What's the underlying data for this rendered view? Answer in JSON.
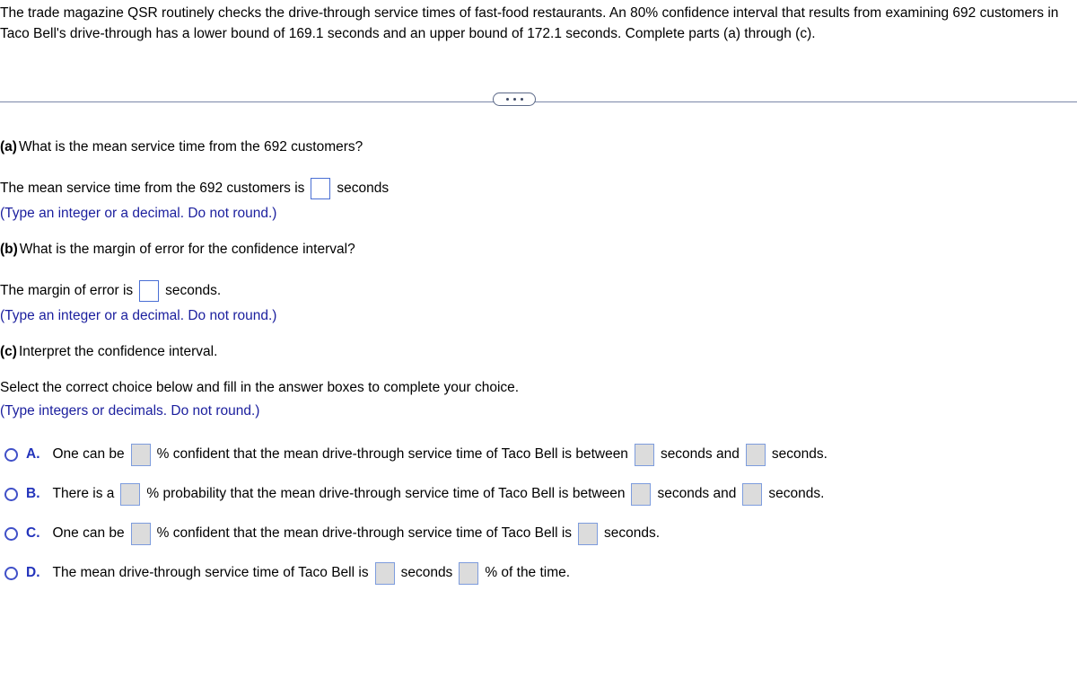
{
  "problem": {
    "statement": "The trade magazine QSR routinely checks the drive-through service times of fast-food restaurants. An 80% confidence interval that results from examining 692 customers in Taco Bell's drive-through has a lower bound of 169.1 seconds and an upper bound of 172.1 seconds. Complete parts (a) through (c).",
    "magazine": "QSR",
    "restaurant": "Taco Bell",
    "confidence_level": "80%",
    "sample_size": "692",
    "lower_bound": "169.1",
    "upper_bound": "172.1"
  },
  "divider": {
    "ellipsis_label": "..."
  },
  "part_a": {
    "label": "(a)",
    "question": "What is the mean service time from the 692 customers?",
    "answer_prefix": "The mean service time from the 692 customers is",
    "answer_suffix": "seconds",
    "answer_value": "",
    "hint": "(Type an integer or a decimal. Do not round.)"
  },
  "part_b": {
    "label": "(b)",
    "question": "What is the margin of error for the confidence interval?",
    "answer_prefix": "The margin of error is",
    "answer_suffix": "seconds.",
    "answer_value": "",
    "hint": "(Type an integer or a decimal. Do not round.)"
  },
  "part_c": {
    "label": "(c)",
    "question": "Interpret the confidence interval.",
    "instruction": "Select the correct choice below and fill in the answer boxes to complete your choice.",
    "hint": "(Type integers or decimals. Do not round.)",
    "choices": [
      {
        "letter": "A.",
        "selected": false,
        "segments": [
          {
            "type": "text",
            "value": "One can be"
          },
          {
            "type": "box",
            "value": ""
          },
          {
            "type": "text",
            "value": "% confident that the mean drive-through service time of Taco Bell is between"
          },
          {
            "type": "box",
            "value": ""
          },
          {
            "type": "text",
            "value": "seconds and"
          },
          {
            "type": "box",
            "value": ""
          },
          {
            "type": "text",
            "value": "seconds."
          }
        ]
      },
      {
        "letter": "B.",
        "selected": false,
        "segments": [
          {
            "type": "text",
            "value": "There is a"
          },
          {
            "type": "box",
            "value": ""
          },
          {
            "type": "text",
            "value": "% probability that the mean drive-through service time of Taco Bell is between"
          },
          {
            "type": "box",
            "value": ""
          },
          {
            "type": "text",
            "value": "seconds and"
          },
          {
            "type": "box",
            "value": ""
          },
          {
            "type": "text",
            "value": "seconds."
          }
        ]
      },
      {
        "letter": "C.",
        "selected": false,
        "segments": [
          {
            "type": "text",
            "value": "One can be"
          },
          {
            "type": "box",
            "value": ""
          },
          {
            "type": "text",
            "value": "% confident that the mean drive-through service time of Taco Bell is"
          },
          {
            "type": "box",
            "value": ""
          },
          {
            "type": "text",
            "value": "seconds."
          }
        ]
      },
      {
        "letter": "D.",
        "selected": false,
        "segments": [
          {
            "type": "text",
            "value": "The mean drive-through service time of Taco Bell is"
          },
          {
            "type": "box",
            "value": ""
          },
          {
            "type": "text",
            "value": "seconds"
          },
          {
            "type": "box",
            "value": ""
          },
          {
            "type": "text",
            "value": "% of the time."
          }
        ]
      }
    ]
  },
  "colors": {
    "hint_blue": "#1b1f9e",
    "choice_letter_blue": "#2233bb",
    "radio_blue": "#4050c8",
    "box_border_white": "#4a6fd4",
    "box_border_gray": "#7d9cdd",
    "box_fill_gray": "#dcdcdc",
    "divider_gray": "#7b87a8"
  }
}
